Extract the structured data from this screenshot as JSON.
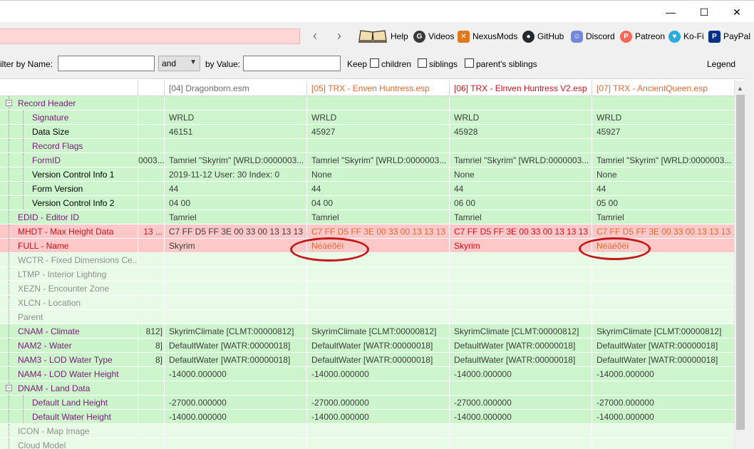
{
  "window": {
    "minimize": "—",
    "maximize": "☐",
    "close": "✕"
  },
  "toolbar": {
    "back": "‹",
    "forward": "›",
    "links": [
      {
        "label": "Help",
        "icon": "book-icon"
      },
      {
        "label": "Videos",
        "icon": "gp-icon"
      },
      {
        "label": "NexusMods",
        "icon": "nexusmods-icon"
      },
      {
        "label": "GitHub",
        "icon": "github-icon"
      },
      {
        "label": "Discord",
        "icon": "discord-icon"
      },
      {
        "label": "Patreon",
        "icon": "patreon-icon"
      },
      {
        "label": "Ko-Fi",
        "icon": "kofi-icon"
      },
      {
        "label": "PayPal",
        "icon": "paypal-icon"
      }
    ]
  },
  "filter": {
    "by_name_label": "ilter by Name:",
    "name_value": "",
    "operator": "and",
    "by_value_label": "by Value:",
    "value_value": "",
    "keep_label": "Keep",
    "children_label": "children",
    "siblings_label": "siblings",
    "parents_siblings_label": "parent's siblings",
    "legend_label": "Legend"
  },
  "columns": [
    {
      "label": "[04] Dragonborn.esm",
      "color": "#6b6b6b"
    },
    {
      "label": "[05] TRX - Enven Huntress.esp",
      "color": "#e26a2c"
    },
    {
      "label": "[06] TRX - Elnven Huntress V2.esp",
      "color": "#d0101c"
    },
    {
      "label": "[07] TRX - AncientQueen.esp",
      "color": "#e26a2c"
    }
  ],
  "colors": {
    "green": "#ccf5cc",
    "light_green": "#e7fbe7",
    "red": "#ffc8c8",
    "name_purple": "#7a1a7a",
    "name_red": "#d0101c",
    "name_gray": "#8e8e8e",
    "cell_orange": "#e26a2c",
    "cell_red": "#d0101c",
    "highlight_ellipse": "#c41818"
  },
  "rows": [
    {
      "name": "Record Header",
      "expander": "−",
      "pre": "",
      "values": [
        "",
        "",
        "",
        ""
      ]
    },
    {
      "name": "Signature",
      "pre": "",
      "values": [
        "WRLD",
        "WRLD",
        "WRLD",
        "WRLD"
      ]
    },
    {
      "name": "Data Size",
      "pre": "",
      "values": [
        "46151",
        "45927",
        "45928",
        "45927"
      ]
    },
    {
      "name": "Record Flags",
      "pre": "",
      "values": [
        "",
        "",
        "",
        ""
      ]
    },
    {
      "name": "FormID",
      "pre": "0003...",
      "values": [
        "Tamriel \"Skyrim\" [WRLD:0000003...",
        "Tamriel \"Skyrim\" [WRLD:0000003...",
        "Tamriel \"Skyrim\" [WRLD:0000003...",
        "Tamriel \"Skyrim\" [WRLD:0000003..."
      ]
    },
    {
      "name": "Version Control Info 1",
      "pre": "",
      "values": [
        "2019-11-12 User: 30 Index: 0",
        "None",
        "None",
        "None"
      ]
    },
    {
      "name": "Form Version",
      "pre": "",
      "values": [
        "44",
        "44",
        "44",
        "44"
      ]
    },
    {
      "name": "Version Control Info 2",
      "pre": "",
      "values": [
        "04 00",
        "04 00",
        "06 00",
        "05 00"
      ]
    },
    {
      "name": "EDID - Editor ID",
      "pre": "",
      "values": [
        "Tamriel",
        "Tamriel",
        "Tamriel",
        "Tamriel"
      ]
    },
    {
      "name": "MHDT - Max Height Data",
      "pre": "13 ...",
      "values": [
        "C7 FF D5 FF 3E 00 33 00 13 13 13 ...",
        "C7 FF D5 FF 3E 00 33 00 13 13 13 ...",
        "C7 FF D5 FF 3E 00 33 00 13 13 13 ...",
        "C7 FF D5 FF 3E 00 33 00 13 13 13 ..."
      ]
    },
    {
      "name": "FULL - Name",
      "pre": "",
      "values": [
        "Skyrim",
        "Néàéõëì",
        "Skyrim",
        "Néàéõëì"
      ]
    },
    {
      "name": "WCTR - Fixed Dimensions Ce...",
      "pre": "",
      "values": [
        "",
        "",
        "",
        ""
      ]
    },
    {
      "name": "LTMP - Interior Lighting",
      "pre": "",
      "values": [
        "",
        "",
        "",
        ""
      ]
    },
    {
      "name": "XEZN - Encounter Zone",
      "pre": "",
      "values": [
        "",
        "",
        "",
        ""
      ]
    },
    {
      "name": "XLCN - Location",
      "pre": "",
      "values": [
        "",
        "",
        "",
        ""
      ]
    },
    {
      "name": "Parent",
      "pre": "",
      "values": [
        "",
        "",
        "",
        ""
      ]
    },
    {
      "name": "CNAM - Climate",
      "pre": "812]",
      "values": [
        "SkyrimClimate [CLMT:00000812]",
        "SkyrimClimate [CLMT:00000812]",
        "SkyrimClimate [CLMT:00000812]",
        "SkyrimClimate [CLMT:00000812]"
      ]
    },
    {
      "name": "NAM2 - Water",
      "pre": "8]",
      "values": [
        "DefaultWater [WATR:00000018]",
        "DefaultWater [WATR:00000018]",
        "DefaultWater [WATR:00000018]",
        "DefaultWater [WATR:00000018]"
      ]
    },
    {
      "name": "NAM3 - LOD Water Type",
      "pre": "8]",
      "values": [
        "DefaultWater [WATR:00000018]",
        "DefaultWater [WATR:00000018]",
        "DefaultWater [WATR:00000018]",
        "DefaultWater [WATR:00000018]"
      ]
    },
    {
      "name": "NAM4 - LOD Water Height",
      "pre": "",
      "values": [
        "-14000.000000",
        "-14000.000000",
        "-14000.000000",
        "-14000.000000"
      ]
    },
    {
      "name": "DNAM - Land Data",
      "expander": "−",
      "pre": "",
      "values": [
        "",
        "",
        "",
        ""
      ]
    },
    {
      "name": "Default Land Height",
      "pre": "",
      "values": [
        "-27000.000000",
        "-27000.000000",
        "-27000.000000",
        "-27000.000000"
      ]
    },
    {
      "name": "Default Water Height",
      "pre": "",
      "values": [
        "-14000.000000",
        "-14000.000000",
        "-14000.000000",
        "-14000.000000"
      ]
    },
    {
      "name": "ICON - Map Image",
      "pre": "",
      "values": [
        "",
        "",
        "",
        ""
      ]
    },
    {
      "name": "Cloud Model",
      "pre": "",
      "values": [
        "",
        "",
        "",
        ""
      ]
    }
  ]
}
